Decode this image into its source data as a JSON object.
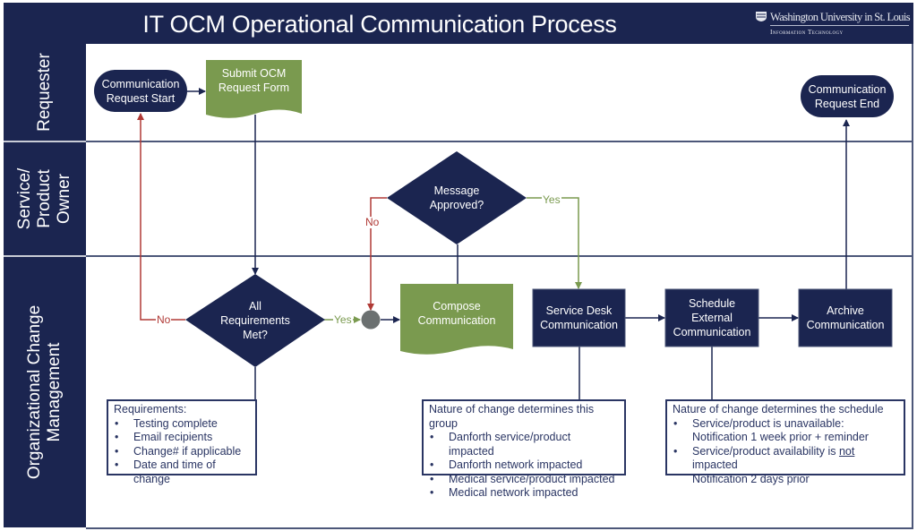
{
  "header": {
    "title": "IT OCM Operational Communication Process",
    "logo_main": "Washington University in St. Louis",
    "logo_sub": "Information Technology"
  },
  "colors": {
    "navy": "#1b2550",
    "green": "#7a9a4f",
    "red": "#b03a36",
    "gray_connector": "#6b7070",
    "line": "#2a3563"
  },
  "lanes": [
    {
      "label": "Requester"
    },
    {
      "label": "Service/\nProduct\nOwner"
    },
    {
      "label": "Organizational Change\nManagement"
    }
  ],
  "nodes": {
    "start": {
      "label": "Communication\nRequest Start",
      "shape": "terminator"
    },
    "submit_form": {
      "label": "Submit OCM\nRequest Form",
      "shape": "document"
    },
    "end": {
      "label": "Communication\nRequest End",
      "shape": "terminator"
    },
    "message_approved": {
      "label": "Message\nApproved?",
      "shape": "decision"
    },
    "all_requirements": {
      "label": "All\nRequirements\nMet?",
      "shape": "decision"
    },
    "compose": {
      "label": "Compose\nCommunication",
      "shape": "document"
    },
    "service_desk": {
      "label": "Service Desk\nCommunication",
      "shape": "process"
    },
    "schedule_external": {
      "label": "Schedule\nExternal\nCommunication",
      "shape": "process"
    },
    "archive": {
      "label": "Archive\nCommunication",
      "shape": "process"
    }
  },
  "edge_labels": {
    "requirements_no": "No",
    "requirements_yes": "Yes",
    "approved_no": "No",
    "approved_yes": "Yes"
  },
  "notes": {
    "requirements": {
      "heading": "Requirements:",
      "items": [
        "Testing complete",
        "Email recipients",
        "Change# if applicable",
        "Date and time of change"
      ]
    },
    "group": {
      "heading": "Nature of change determines this group",
      "items": [
        "Danforth service/product impacted",
        "Danforth network impacted",
        "Medical service/product impacted",
        "Medical network impacted"
      ]
    },
    "schedule": {
      "heading": "Nature of change determines the schedule",
      "items": [
        {
          "line1": "Service/product is unavailable:",
          "line2": "Notification 1 week prior + reminder"
        },
        {
          "line1_pre": "Service/product availability is ",
          "line1_emph": "not",
          "line1_post": " impacted",
          "line2": "Notification 2 days prior"
        }
      ]
    }
  }
}
